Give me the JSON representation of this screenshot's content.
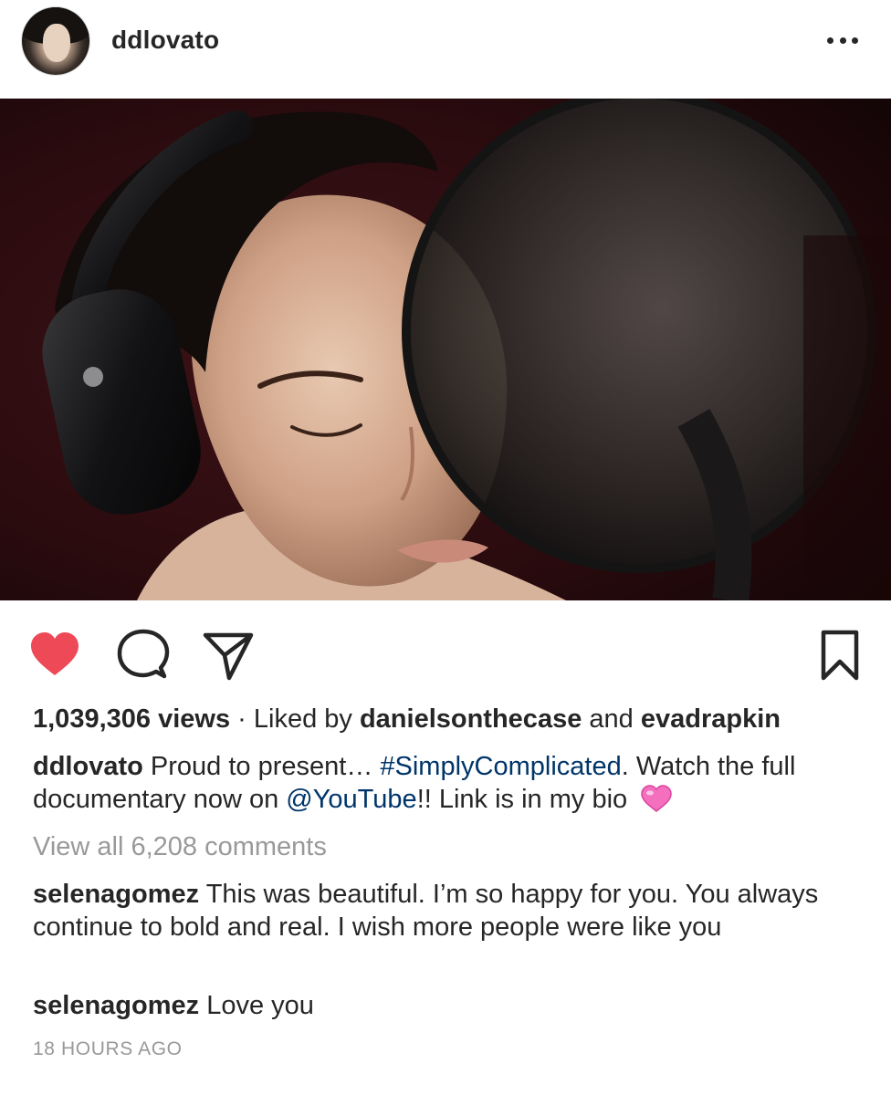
{
  "header": {
    "username": "ddlovato",
    "avatar": "profile-photo",
    "more_icon": "more-horizontal-icon"
  },
  "photo": {
    "description_icon": "post-photo"
  },
  "actions": {
    "like_icon": "heart-filled-icon",
    "comment_icon": "comment-icon",
    "share_icon": "paper-plane-icon",
    "save_icon": "bookmark-icon",
    "like_color": "#ed4956"
  },
  "stats": {
    "views": "1,039,306 views",
    "separator": "·",
    "liked_by_prefix": "Liked by",
    "liked_by_user1": "danielsonthecase",
    "liked_by_and": "and",
    "liked_by_user2": "evadrapkin"
  },
  "caption": {
    "username": "ddlovato",
    "text_before_hashtag": "Proud to present…",
    "hashtag": "#SimplyComplicated",
    "text_after_hashtag": ". Watch the full documentary now on",
    "mention": "@YouTube",
    "text_after_mention": "!! Link is in my bio",
    "emoji": "pink-heart-emoji"
  },
  "comments": {
    "view_all": "View all 6,208 comments",
    "items": [
      {
        "username": "selenagomez",
        "text": "This was beautiful. I’m so happy for you. You always continue to bold and real. I wish more people were like you"
      },
      {
        "username": "selenagomez",
        "text": "Love you"
      }
    ]
  },
  "timestamp": "18 HOURS AGO",
  "colors": {
    "text": "#262626",
    "link": "#003569",
    "muted": "#999999",
    "like": "#ed4956"
  }
}
